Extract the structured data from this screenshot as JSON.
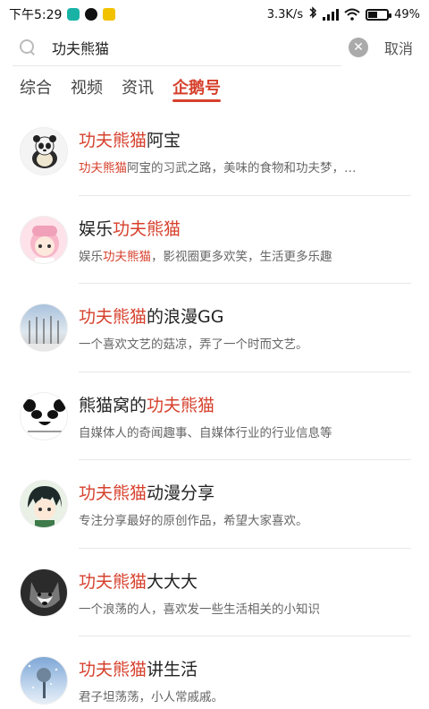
{
  "status_bar": {
    "time": "下午5:29",
    "net_speed": "3.3K/s",
    "battery": "49%",
    "battery_level": 0.49,
    "icons": [
      "shield-app-icon",
      "tiktok-app-icon",
      "yellow-app-icon",
      "bluetooth-icon",
      "signal-icon",
      "wifi-icon",
      "battery-icon"
    ]
  },
  "search": {
    "query": "功夫熊猫",
    "clear_icon": "clear-icon",
    "cancel_label": "取消"
  },
  "tabs": [
    {
      "label": "综合",
      "active": false
    },
    {
      "label": "视频",
      "active": false
    },
    {
      "label": "资讯",
      "active": false
    },
    {
      "label": "企鹅号",
      "active": true
    }
  ],
  "accent_color": "#d6402c",
  "results": [
    {
      "name_pre": "",
      "name_hl": "功夫熊猫",
      "name_post": "阿宝",
      "desc_pre": "",
      "desc_hl": "功夫熊猫",
      "desc_post": "阿宝的习武之路，美味的食物和功夫梦，…"
    },
    {
      "name_pre": "娱乐",
      "name_hl": "功夫熊猫",
      "name_post": "",
      "desc_pre": "娱乐",
      "desc_hl": "功夫熊猫",
      "desc_post": "，影视圈更多欢笑，生活更多乐趣"
    },
    {
      "name_pre": "",
      "name_hl": "功夫熊猫",
      "name_post": "的浪漫GG",
      "desc_pre": "",
      "desc_hl": "",
      "desc_post": "一个喜欢文艺的菇凉，弄了一个时而文艺。"
    },
    {
      "name_pre": "熊猫窝的",
      "name_hl": "功夫熊猫",
      "name_post": "",
      "desc_pre": "",
      "desc_hl": "",
      "desc_post": "自媒体人的奇闻趣事、自媒体行业的行业信息等"
    },
    {
      "name_pre": "",
      "name_hl": "功夫熊猫",
      "name_post": "动漫分享",
      "desc_pre": "",
      "desc_hl": "",
      "desc_post": "专注分享最好的原创作品，希望大家喜欢。"
    },
    {
      "name_pre": "",
      "name_hl": "功夫熊猫",
      "name_post": "大大大",
      "desc_pre": "",
      "desc_hl": "",
      "desc_post": "一个浪荡的人，喜欢发一些生活相关的小知识"
    },
    {
      "name_pre": "",
      "name_hl": "功夫熊猫",
      "name_post": "讲生活",
      "desc_pre": "",
      "desc_hl": "",
      "desc_post": "君子坦荡荡，小人常戚戚。"
    }
  ]
}
